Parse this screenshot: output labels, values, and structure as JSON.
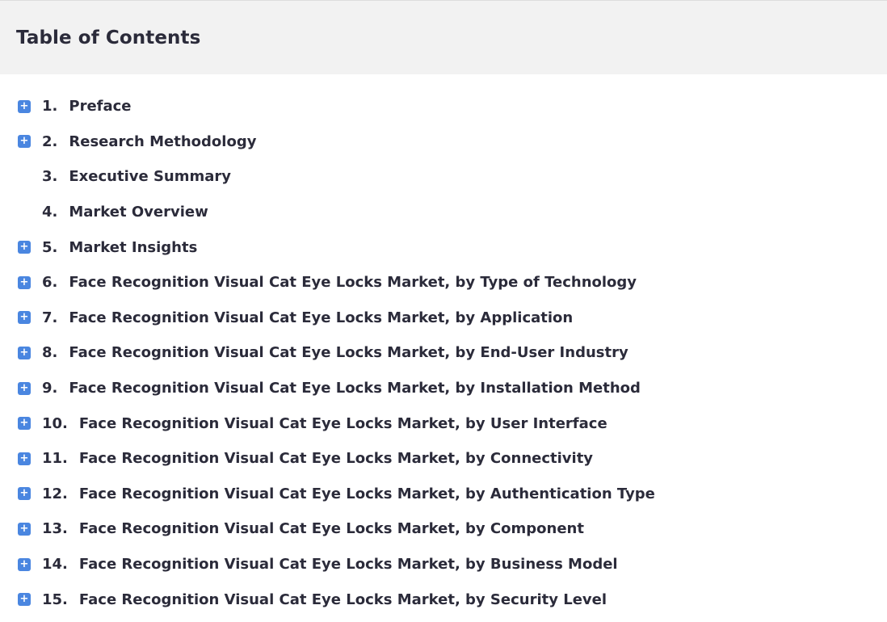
{
  "toc": {
    "title": "Table of Contents",
    "toggle_symbol": "+",
    "items": [
      {
        "number": "1.",
        "label": "Preface",
        "expandable": true
      },
      {
        "number": "2.",
        "label": "Research Methodology",
        "expandable": true
      },
      {
        "number": "3.",
        "label": "Executive Summary",
        "expandable": false
      },
      {
        "number": "4.",
        "label": "Market Overview",
        "expandable": false
      },
      {
        "number": "5.",
        "label": "Market Insights",
        "expandable": true
      },
      {
        "number": "6.",
        "label": "Face Recognition Visual Cat Eye Locks Market, by Type of Technology",
        "expandable": true
      },
      {
        "number": "7.",
        "label": "Face Recognition Visual Cat Eye Locks Market, by Application",
        "expandable": true
      },
      {
        "number": "8.",
        "label": "Face Recognition Visual Cat Eye Locks Market, by End-User Industry",
        "expandable": true
      },
      {
        "number": "9.",
        "label": "Face Recognition Visual Cat Eye Locks Market, by Installation Method",
        "expandable": true
      },
      {
        "number": "10.",
        "label": "Face Recognition Visual Cat Eye Locks Market, by User Interface",
        "expandable": true
      },
      {
        "number": "11.",
        "label": "Face Recognition Visual Cat Eye Locks Market, by Connectivity",
        "expandable": true
      },
      {
        "number": "12.",
        "label": "Face Recognition Visual Cat Eye Locks Market, by Authentication Type",
        "expandable": true
      },
      {
        "number": "13.",
        "label": "Face Recognition Visual Cat Eye Locks Market, by Component",
        "expandable": true
      },
      {
        "number": "14.",
        "label": "Face Recognition Visual Cat Eye Locks Market, by Business Model",
        "expandable": true
      },
      {
        "number": "15.",
        "label": "Face Recognition Visual Cat Eye Locks Market, by Security Level",
        "expandable": true
      }
    ]
  },
  "colors": {
    "header_bg": "#f2f2f2",
    "toggle_bg": "#4a86e0",
    "text": "#2b2b3a"
  },
  "icons": {
    "toggle": "expand-plus-icon"
  }
}
